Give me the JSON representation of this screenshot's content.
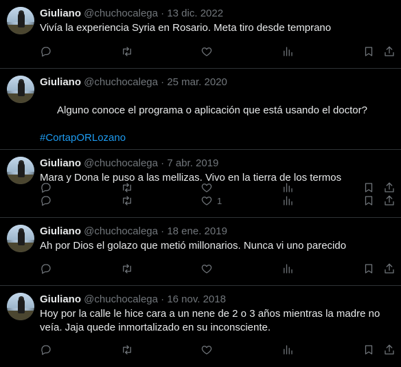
{
  "tweets": [
    {
      "name": "Giuliano",
      "handle": "@chuchocalega",
      "separator": "·",
      "date": "13 dic. 2022",
      "text": "Viví­a la experiencia Syria en Rosario. Meta tiro desde temprano",
      "hashtag": "",
      "likes": ""
    },
    {
      "name": "Giuliano",
      "handle": "@chuchocalega",
      "separator": "·",
      "date": "25 mar. 2020",
      "text": "Alguno conoce el programa o aplicación que está usando el doctor?",
      "hashtag": "#CortapORLozano",
      "likes": ""
    },
    {
      "name": "Giuliano",
      "handle": "@chuchocalega",
      "separator": "·",
      "date": "7 abr. 2019",
      "text": "Mara y Dona le puso a las mellizas. Vivo en la tierra de los termos",
      "hashtag": "",
      "likes": "1"
    },
    {
      "name": "Giuliano",
      "handle": "@chuchocalega",
      "separator": "·",
      "date": "18 ene. 2019",
      "text": "Ah por Dios el golazo que metió millonarios. Nunca vi uno parecido",
      "hashtag": "",
      "likes": ""
    },
    {
      "name": "Giuliano",
      "handle": "@chuchocalega",
      "separator": "·",
      "date": "16 nov. 2018",
      "text": "Hoy por la calle le hice cara a un nene de 2 o 3 años mientras la madre no\nveía. Jaja quede inmortalizado en su inconsciente.",
      "hashtag": "",
      "likes": ""
    }
  ],
  "icons": {
    "reply": "reply-icon",
    "retweet": "retweet-icon",
    "like": "heart-icon",
    "views": "views-icon",
    "bookmark": "bookmark-icon",
    "share": "share-icon"
  },
  "colors": {
    "background": "#000000",
    "text": "#e7e9ea",
    "secondary": "#71767b",
    "link": "#1d9bf0",
    "divider": "#2f3336"
  }
}
